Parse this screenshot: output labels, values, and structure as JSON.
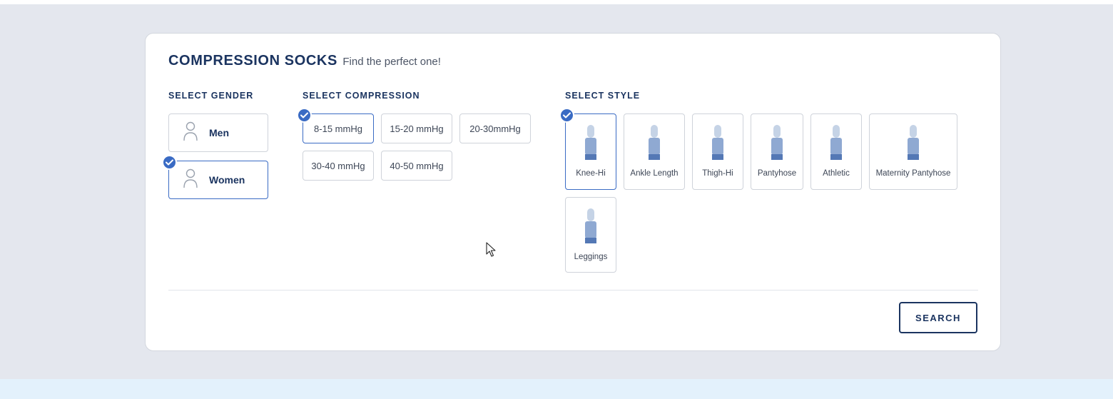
{
  "title": "COMPRESSION SOCKS",
  "subtitle": "Find the perfect one!",
  "gender": {
    "label": "SELECT GENDER",
    "options": [
      "Men",
      "Women"
    ],
    "selected": "Women"
  },
  "compression": {
    "label": "SELECT COMPRESSION",
    "options": [
      "8-15 mmHg",
      "15-20 mmHg",
      "20-30mmHg",
      "30-40 mmHg",
      "40-50 mmHg"
    ],
    "selected": "8-15 mmHg"
  },
  "style": {
    "label": "SELECT STYLE",
    "options": [
      "Knee-Hi",
      "Ankle Length",
      "Thigh-Hi",
      "Pantyhose",
      "Athletic",
      "Maternity Pantyhose",
      "Leggings"
    ],
    "selected": "Knee-Hi"
  },
  "search_label": "SEARCH",
  "colors": {
    "primary": "#1b3460",
    "accent": "#3a6bc4",
    "sock_light": "#c5d3e6",
    "sock_mid": "#8fa9d2",
    "sock_dark": "#5478b5"
  },
  "icons": {
    "check": "check-icon",
    "person": "person-icon",
    "sock": "sock-icon",
    "cursor": "mouse-cursor-icon"
  }
}
